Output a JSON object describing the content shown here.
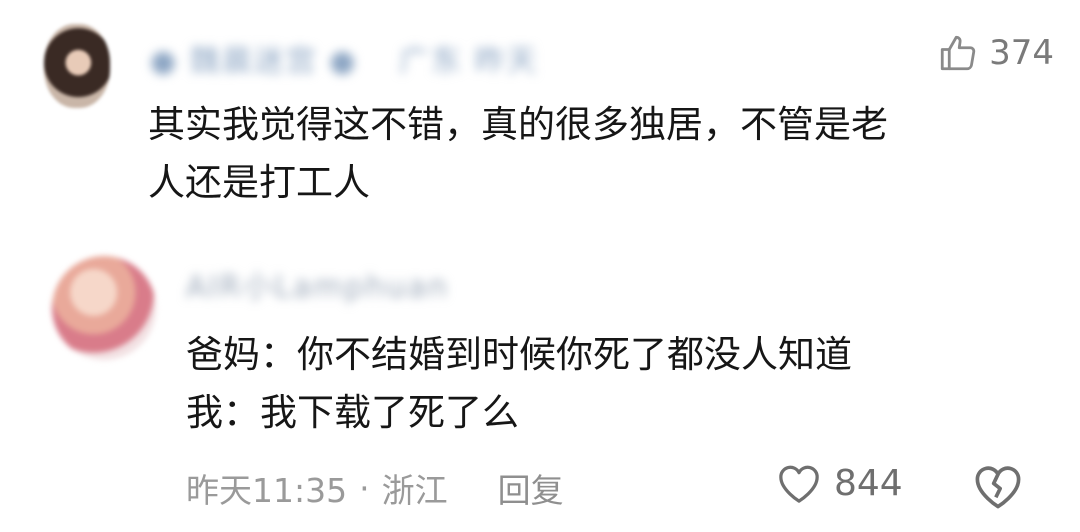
{
  "comment1": {
    "username": "● 魏晨迷宫 ●",
    "location_tags": "广东  昨天",
    "likes": "374",
    "text_line1": "其实我觉得这不错，真的很多独居，不管是老",
    "text_line2": "人还是打工人"
  },
  "comment2": {
    "username": "AIR小Lamphuan",
    "text_line1": "爸妈：你不结婚到时候你死了都没人知道",
    "text_line2": "我：我下载了死了么",
    "time": "昨天11:35",
    "separator": "·",
    "location": "浙江",
    "reply_label": "回复",
    "likes": "844"
  },
  "icons": {
    "like": "thumbs-up-icon",
    "heart": "heart-outline-icon",
    "dislike": "broken-heart-icon"
  },
  "colors": {
    "text": "#161616",
    "muted": "#9a9a9a",
    "username_blur": "#8da6c4"
  }
}
